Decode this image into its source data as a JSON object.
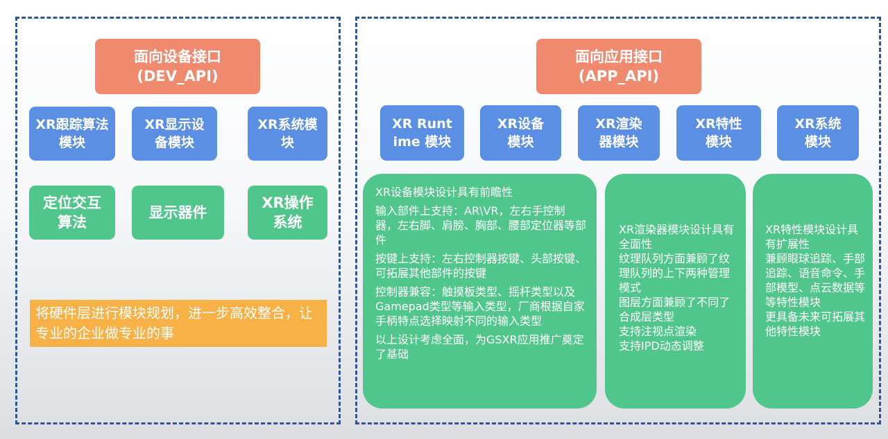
{
  "dev_api": {
    "header_line1": "面向设备接口",
    "header_line2": "(DEV_API)",
    "modules": [
      "XR跟踪算法模块",
      "XR显示设备模块",
      "XR系统模块"
    ],
    "components": [
      "定位交互算法",
      "显示器件",
      "XR操作系统"
    ],
    "highlight": "将硬件层进行模块规划，进一步高效整合，让专业的企业做专业的事"
  },
  "app_api": {
    "header_line1": "面向应用接口",
    "header_line2": "(APP_API)",
    "modules": [
      "XR Runtime 模块",
      "XR设备模块",
      "XR渲染器模块",
      "XR特性模块",
      "XR系统模块"
    ],
    "device_card": [
      "XR设备模块设计具有前瞻性",
      "输入部件上支持：AR\\VR，左右手控制器，左右脚、肩膀、胸部、腰部定位器等部件",
      "按键上支持：左右控制器按键、头部按键、可拓展其他部件的按键",
      "控制器兼容：触摸板类型、摇杆类型以及Gamepad类型等输入类型，厂商根据自家手柄特点选择映射不同的输入类型",
      "以上设计考虑全面，为GSXR应用推广奠定了基础"
    ],
    "render_card": [
      "XR渲染器模块设计具有全面性",
      "纹理队列方面兼顾了纹理队列的上下两种管理模式",
      "图层方面兼顾了不同了合成层类型",
      "支持注视点渲染",
      "支持IPD动态调整"
    ],
    "feature_card": [
      "XR特性模块设计具有扩展性",
      "兼顾眼球追踪、手部追踪、语音命令、手部模型、点云数据等等特性模块",
      "更具备未来可拓展其他特性模块"
    ]
  },
  "colors": {
    "border": "#2f5597",
    "header": "#f08a6e",
    "module": "#5b8fe3",
    "green": "#51c68c",
    "highlight": "#f7b146"
  }
}
